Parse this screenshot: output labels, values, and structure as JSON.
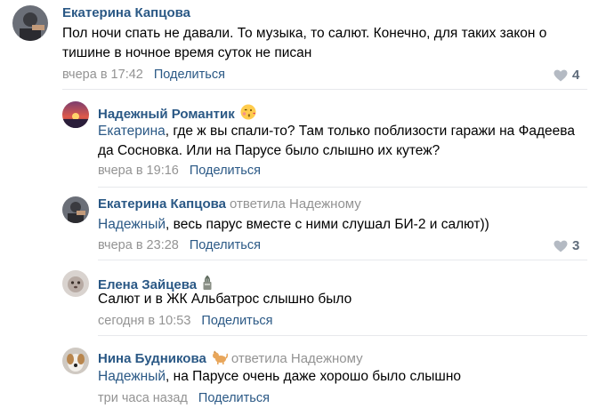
{
  "comments": [
    {
      "author": "Екатерина Капцова",
      "reply_to": "",
      "mention": "",
      "text": "Пол ночи спать не давали. То музыка, то салют. Конечно, для таких закон о тишине в ночное время суток не писан",
      "date": "вчера в 17:42",
      "share": "Поделиться",
      "likes": "4"
    },
    {
      "author": "Надежный Романтик",
      "reply_to": "",
      "mention": "Екатерина",
      "text": ", где ж вы спали-то? Там только поблизости гаражи на Фадеева да Сосновка. Или на Парусе было слышно их кутеж?",
      "date": "вчера в 19:16",
      "share": "Поделиться",
      "likes": ""
    },
    {
      "author": "Екатерина Капцова",
      "reply_to": "ответила Надежному",
      "mention": "Надежный",
      "text": ", весь парус вместе с ними слушал БИ-2 и салют))",
      "date": "вчера в 23:28",
      "share": "Поделиться",
      "likes": "3"
    },
    {
      "author": "Елена Зайцева",
      "reply_to": "",
      "mention": "",
      "text": "Салют и в ЖК Альбатрос слышно было",
      "date": "сегодня в 10:53",
      "share": "Поделиться",
      "likes": ""
    },
    {
      "author": "Нина Будникова",
      "reply_to": "ответила Надежному",
      "mention": "Надежный",
      "text": ", на Парусе очень даже хорошо было слышно",
      "date": "три часа назад",
      "share": "Поделиться",
      "likes": ""
    }
  ],
  "icons": {
    "like": "heart-icon",
    "emoji_romantic": "kissing-face-emoji",
    "emoji_zaitseva": "flower-pot-emoji",
    "emoji_budnikova": "dog-emoji"
  },
  "colors": {
    "link": "#2a5885",
    "meta": "#939393",
    "divider": "#e7e8ec"
  }
}
